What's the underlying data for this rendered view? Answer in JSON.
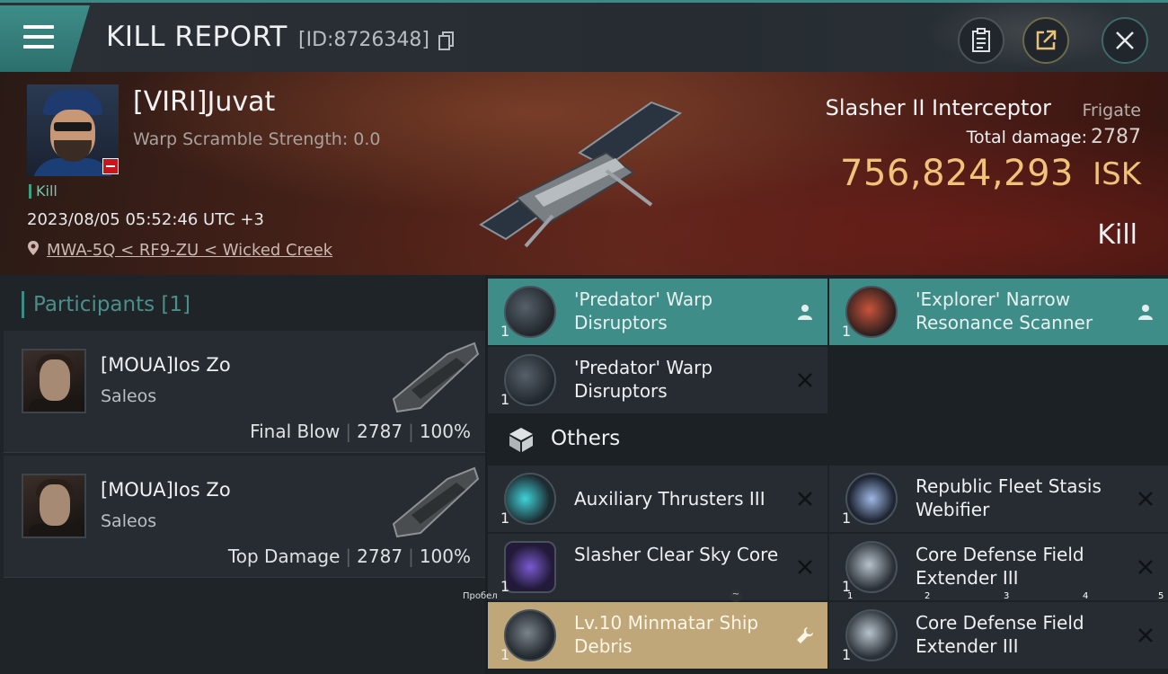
{
  "header": {
    "title": "KILL REPORT",
    "report_id": "[ID:8726348]"
  },
  "victim": {
    "name": "[VIRI]Juvat",
    "scramble": "Warp Scramble Strength: 0.0",
    "kill_tag": "Kill",
    "datetime": "2023/08/05 05:52:46 UTC +3",
    "location": "MWA-5Q < RF9-ZU < Wicked Creek",
    "ship_name": "Slasher II Interceptor",
    "ship_class": "Frigate",
    "total_damage_label": "Total damage:",
    "total_damage": "2787",
    "isk_value": "756,824,293",
    "isk_unit": "ISK",
    "result": "Kill"
  },
  "participants": {
    "header_label": "Participants",
    "header_count": "[1]",
    "list": [
      {
        "name": "[MOUA]Ios Zo",
        "ship": "Saleos",
        "role": "Final Blow",
        "damage": "2787",
        "percent": "100%"
      },
      {
        "name": "[MOUA]Ios Zo",
        "ship": "Saleos",
        "role": "Top Damage",
        "damage": "2787",
        "percent": "100%"
      }
    ]
  },
  "items": {
    "fitted": [
      {
        "name": "'Predator' Warp Disruptors",
        "qty": "1",
        "state": "pilot"
      },
      {
        "name": "'Explorer' Narrow Resonance Scanner",
        "qty": "1",
        "state": "pilot"
      },
      {
        "name": "'Predator' Warp Disruptors",
        "qty": "1",
        "state": "destroyed"
      }
    ],
    "others_label": "Others",
    "others": [
      {
        "name": "Auxiliary Thrusters III",
        "qty": "1",
        "state": "destroyed"
      },
      {
        "name": "Republic Fleet Stasis Webifier",
        "qty": "1",
        "state": "destroyed"
      },
      {
        "name": "Slasher Clear Sky Core",
        "qty": "1",
        "state": "destroyed"
      },
      {
        "name": "Core Defense Field Extender III",
        "qty": "1",
        "state": "destroyed"
      },
      {
        "name": "Lv.10 Minmatar Ship Debris",
        "qty": "1",
        "state": "dropped"
      },
      {
        "name": "Core Defense Field Extender III",
        "qty": "1",
        "state": "destroyed"
      }
    ]
  },
  "overlay": {
    "keytip": "Пробел",
    "keytip2": "~",
    "marks": [
      "1",
      "2",
      "3",
      "4",
      "5"
    ]
  },
  "colors": {
    "accent_teal": "#3f8d88",
    "isk_gold": "#f0c27a",
    "dropped_gold": "#bfa77a"
  }
}
